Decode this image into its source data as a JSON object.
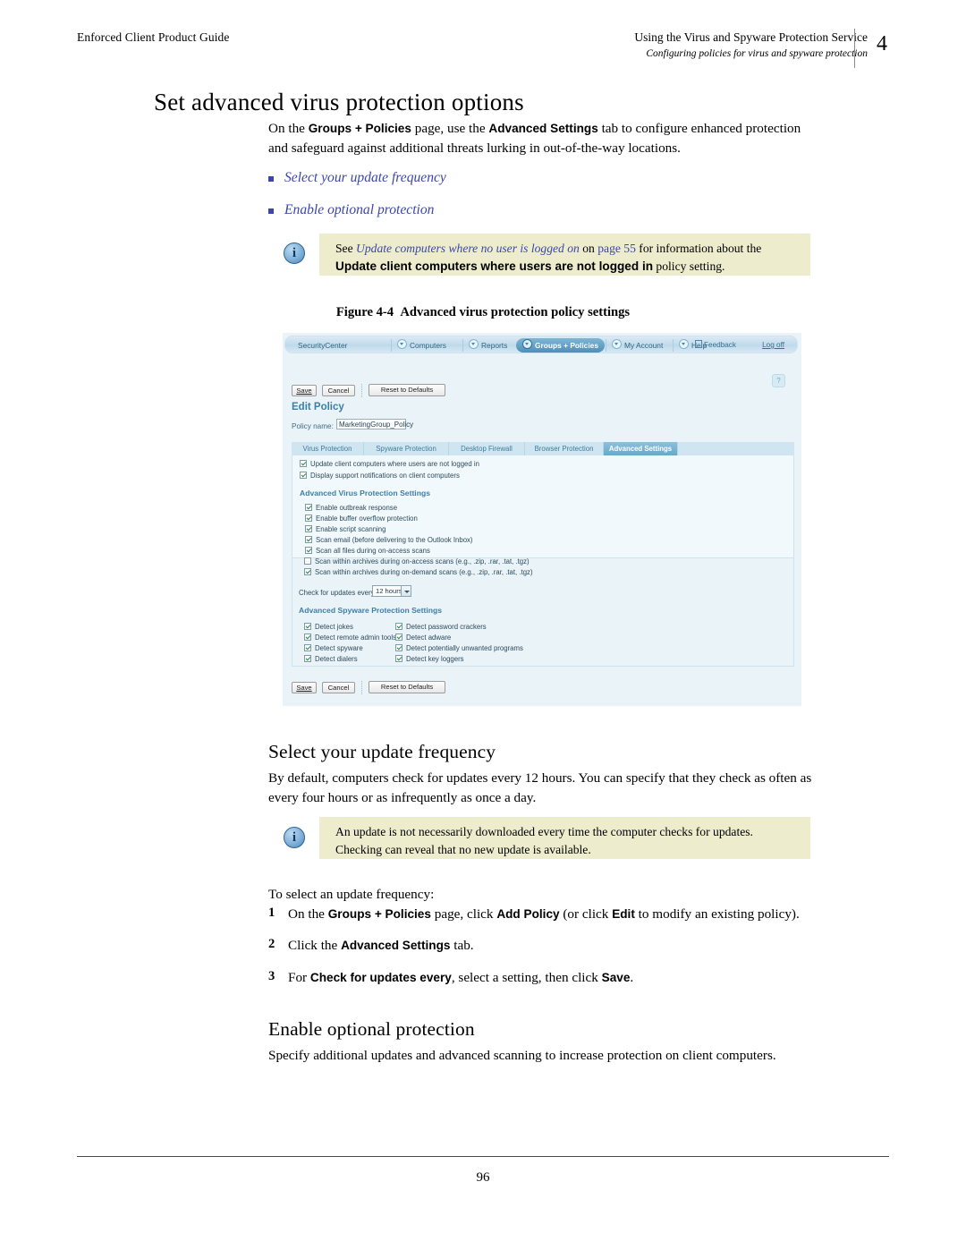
{
  "header": {
    "left": "Enforced Client Product Guide",
    "right_line1": "Using the Virus and Spyware Protection Service",
    "right_line2": "Configuring policies for virus and spyware protection",
    "chapter": "4"
  },
  "title": "Set advanced virus protection options",
  "intro": {
    "part1": "On the ",
    "bold1": "Groups + Policies",
    "part2": " page, use the ",
    "bold2": "Advanced Settings",
    "part3": " tab to configure enhanced protection and safeguard against additional threats lurking in out-of-the-way locations."
  },
  "bullets": [
    "Select your update frequency",
    "Enable optional protection"
  ],
  "note1": {
    "icon": "info-icon",
    "text_see": "See ",
    "link": "Update computers where no user is logged on",
    "text_on": " on ",
    "page_ref": "page 55",
    "text_mid": " for information about the ",
    "bold": "Update client computers where users are not logged in",
    "text_end": " policy setting."
  },
  "figure": {
    "caption_label": "Figure 4-4",
    "caption_text": "Advanced virus protection policy settings",
    "app": {
      "nav": {
        "brand": "SecurityCenter",
        "items": [
          {
            "label": "Computers",
            "active": false
          },
          {
            "label": "Reports",
            "active": false
          },
          {
            "label": "Groups + Policies",
            "active": true
          },
          {
            "label": "My Account",
            "active": false
          },
          {
            "label": "Help",
            "active": false
          }
        ],
        "feedback": "Feedback",
        "logoff": "Log off"
      },
      "help_button": "?",
      "toolbar": {
        "save": "Save",
        "cancel": "Cancel",
        "reset": "Reset to Defaults"
      },
      "edit_policy_heading": "Edit Policy",
      "policy_name_label": "Policy name:",
      "policy_name_value": "MarketingGroup_Policy",
      "tabs": [
        {
          "label": "Virus Protection",
          "active": false
        },
        {
          "label": "Spyware Protection",
          "active": false
        },
        {
          "label": "Desktop Firewall",
          "active": false
        },
        {
          "label": "Browser Protection",
          "active": false
        },
        {
          "label": "Advanced Settings",
          "active": true
        }
      ],
      "top_options": [
        {
          "label": "Update client computers where users are not logged in",
          "checked": true
        },
        {
          "label": "Display support notifications on client computers",
          "checked": true
        }
      ],
      "virus_section_heading": "Advanced Virus Protection Settings",
      "virus_options": [
        {
          "label": "Enable outbreak response",
          "checked": true
        },
        {
          "label": "Enable buffer overflow protection",
          "checked": true
        },
        {
          "label": "Enable script scanning",
          "checked": true
        },
        {
          "label": "Scan email (before delivering to the Outlook Inbox)",
          "checked": true
        },
        {
          "label": "Scan all files during on-access scans",
          "checked": true
        },
        {
          "label": "Scan within archives during on-access scans (e.g., .zip, .rar, .tat, .tgz)",
          "checked": false
        },
        {
          "label": "Scan within archives during on-demand scans (e.g., .zip, .rar, .tat, .tgz)",
          "checked": true
        }
      ],
      "update_label": "Check for updates every",
      "update_value": "12 hours",
      "spyware_section_heading": "Advanced Spyware Protection Settings",
      "spyware_left": [
        {
          "label": "Detect jokes",
          "checked": true
        },
        {
          "label": "Detect remote admin tools",
          "checked": true
        },
        {
          "label": "Detect spyware",
          "checked": true
        },
        {
          "label": "Detect dialers",
          "checked": true
        }
      ],
      "spyware_right": [
        {
          "label": "Detect password crackers",
          "checked": true
        },
        {
          "label": "Detect adware",
          "checked": true
        },
        {
          "label": "Detect potentially unwanted programs",
          "checked": true
        },
        {
          "label": "Detect key loggers",
          "checked": true
        }
      ]
    }
  },
  "section_update": {
    "heading": "Select your update frequency",
    "body": "By default, computers check for updates every 12 hours. You can specify that they check as often as every four hours or as infrequently as once a day.",
    "note": {
      "icon": "info-icon",
      "line1": "An update is not necessarily downloaded every time the computer checks for updates.",
      "line2": "Checking can reveal that no new update is available."
    },
    "procedure_intro": "To select an update frequency:",
    "steps": [
      {
        "num": "1",
        "a": "On the ",
        "b1": "Groups + Policies",
        "c": " page, click ",
        "b2": "Add Policy",
        "d": " (or click ",
        "b3": "Edit",
        "e": " to modify an existing policy)."
      },
      {
        "num": "2",
        "a": "Click the ",
        "b1": "Advanced Settings",
        "c": " tab.",
        "b2": "",
        "d": "",
        "b3": "",
        "e": ""
      },
      {
        "num": "3",
        "a": "For ",
        "b1": "Check for updates every",
        "c": ", select a setting, then click ",
        "b2": "Save",
        "d": ".",
        "b3": "",
        "e": ""
      }
    ]
  },
  "section_optional": {
    "heading": "Enable optional protection",
    "body": "Specify additional updates and advanced scanning to increase protection on client computers."
  },
  "footer": {
    "page_number": "96"
  },
  "colors": {
    "link": "#3b46a8",
    "note_bg": "#edeccd",
    "app_accent": "#3d7fa6"
  }
}
